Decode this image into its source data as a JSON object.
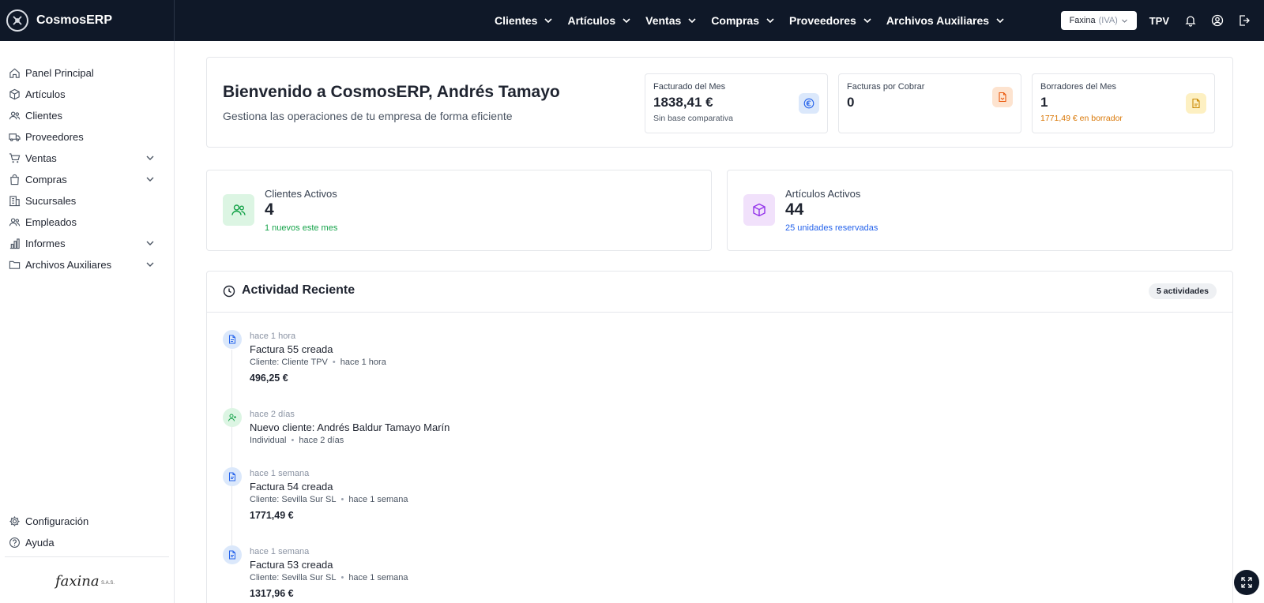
{
  "app": {
    "name": "CosmosERP"
  },
  "topnav": [
    {
      "label": "Clientes"
    },
    {
      "label": "Artículos"
    },
    {
      "label": "Ventas"
    },
    {
      "label": "Compras"
    },
    {
      "label": "Proveedores"
    },
    {
      "label": "Archivos Auxiliares"
    }
  ],
  "topbar": {
    "company_name": "Faxina",
    "company_tax": "(IVA)",
    "tpv_label": "TPV"
  },
  "sidebar": {
    "items": [
      {
        "label": "Panel Principal",
        "icon": "home-icon"
      },
      {
        "label": "Artículos",
        "icon": "box-icon"
      },
      {
        "label": "Clientes",
        "icon": "users-icon"
      },
      {
        "label": "Proveedores",
        "icon": "truck-icon"
      },
      {
        "label": "Ventas",
        "icon": "cart-icon",
        "expandable": true
      },
      {
        "label": "Compras",
        "icon": "bag-icon",
        "expandable": true
      },
      {
        "label": "Sucursales",
        "icon": "building-icon"
      },
      {
        "label": "Empleados",
        "icon": "users-icon"
      },
      {
        "label": "Informes",
        "icon": "bar-chart-icon",
        "expandable": true
      },
      {
        "label": "Archivos Auxiliares",
        "icon": "folder-icon",
        "expandable": true
      }
    ],
    "bottom": [
      {
        "label": "Configuración",
        "icon": "gear-icon"
      },
      {
        "label": "Ayuda",
        "icon": "help-icon"
      }
    ],
    "logo_text": "faxina",
    "logo_sub": "S.A.S."
  },
  "welcome": {
    "title": "Bienvenido a CosmosERP, Andrés Tamayo",
    "subtitle": "Gestiona las operaciones de tu empresa de forma eficiente"
  },
  "stats": [
    {
      "label": "Facturado del Mes",
      "value": "1838,41 €",
      "note": "Sin base comparativa",
      "icon": "euro-icon",
      "color": "#4b5563"
    },
    {
      "label": "Facturas por Cobrar",
      "value": "0",
      "note": "",
      "icon": "invoice-icon",
      "color": "#4b5563"
    },
    {
      "label": "Borradores del Mes",
      "value": "1",
      "note": "1771,49 € en borrador",
      "icon": "draft-icon",
      "color": "#d97706"
    }
  ],
  "metrics": [
    {
      "label": "Clientes Activos",
      "value": "4",
      "note": "1 nuevos este mes",
      "icon": "users-icon",
      "color": "#16a34a"
    },
    {
      "label": "Artículos Activos",
      "value": "44",
      "note": "25 unidades reservadas",
      "icon": "box-icon",
      "color": "#2563eb"
    }
  ],
  "activity": {
    "title": "Actividad Reciente",
    "badge": "5 actividades",
    "items": [
      {
        "time": "hace 1 hora",
        "title": "Factura 55 creada",
        "meta_a": "Cliente: Cliente TPV",
        "meta_b": "hace 1 hora",
        "amount": "496,25 €",
        "icon": "invoice-icon"
      },
      {
        "time": "hace 2 días",
        "title": "Nuevo cliente: Andrés Baldur Tamayo Marín",
        "meta_a": "Individual",
        "meta_b": "hace 2 días",
        "amount": "",
        "icon": "user-plus-icon"
      },
      {
        "time": "hace 1 semana",
        "title": "Factura 54 creada",
        "meta_a": "Cliente: Sevilla Sur SL",
        "meta_b": "hace 1 semana",
        "amount": "1771,49 €",
        "icon": "invoice-icon"
      },
      {
        "time": "hace 1 semana",
        "title": "Factura 53 creada",
        "meta_a": "Cliente: Sevilla Sur SL",
        "meta_b": "hace 1 semana",
        "amount": "1317,96 €",
        "icon": "invoice-icon"
      }
    ]
  },
  "colors": {
    "topbar_bg": "#0f1828",
    "euro_bg": "#dbe8fb",
    "invoice_bg": "#fde3cf",
    "draft_bg": "#fdf0c2",
    "clients_bg": "#dcf5e3",
    "articles_bg": "#f1e1fb"
  }
}
